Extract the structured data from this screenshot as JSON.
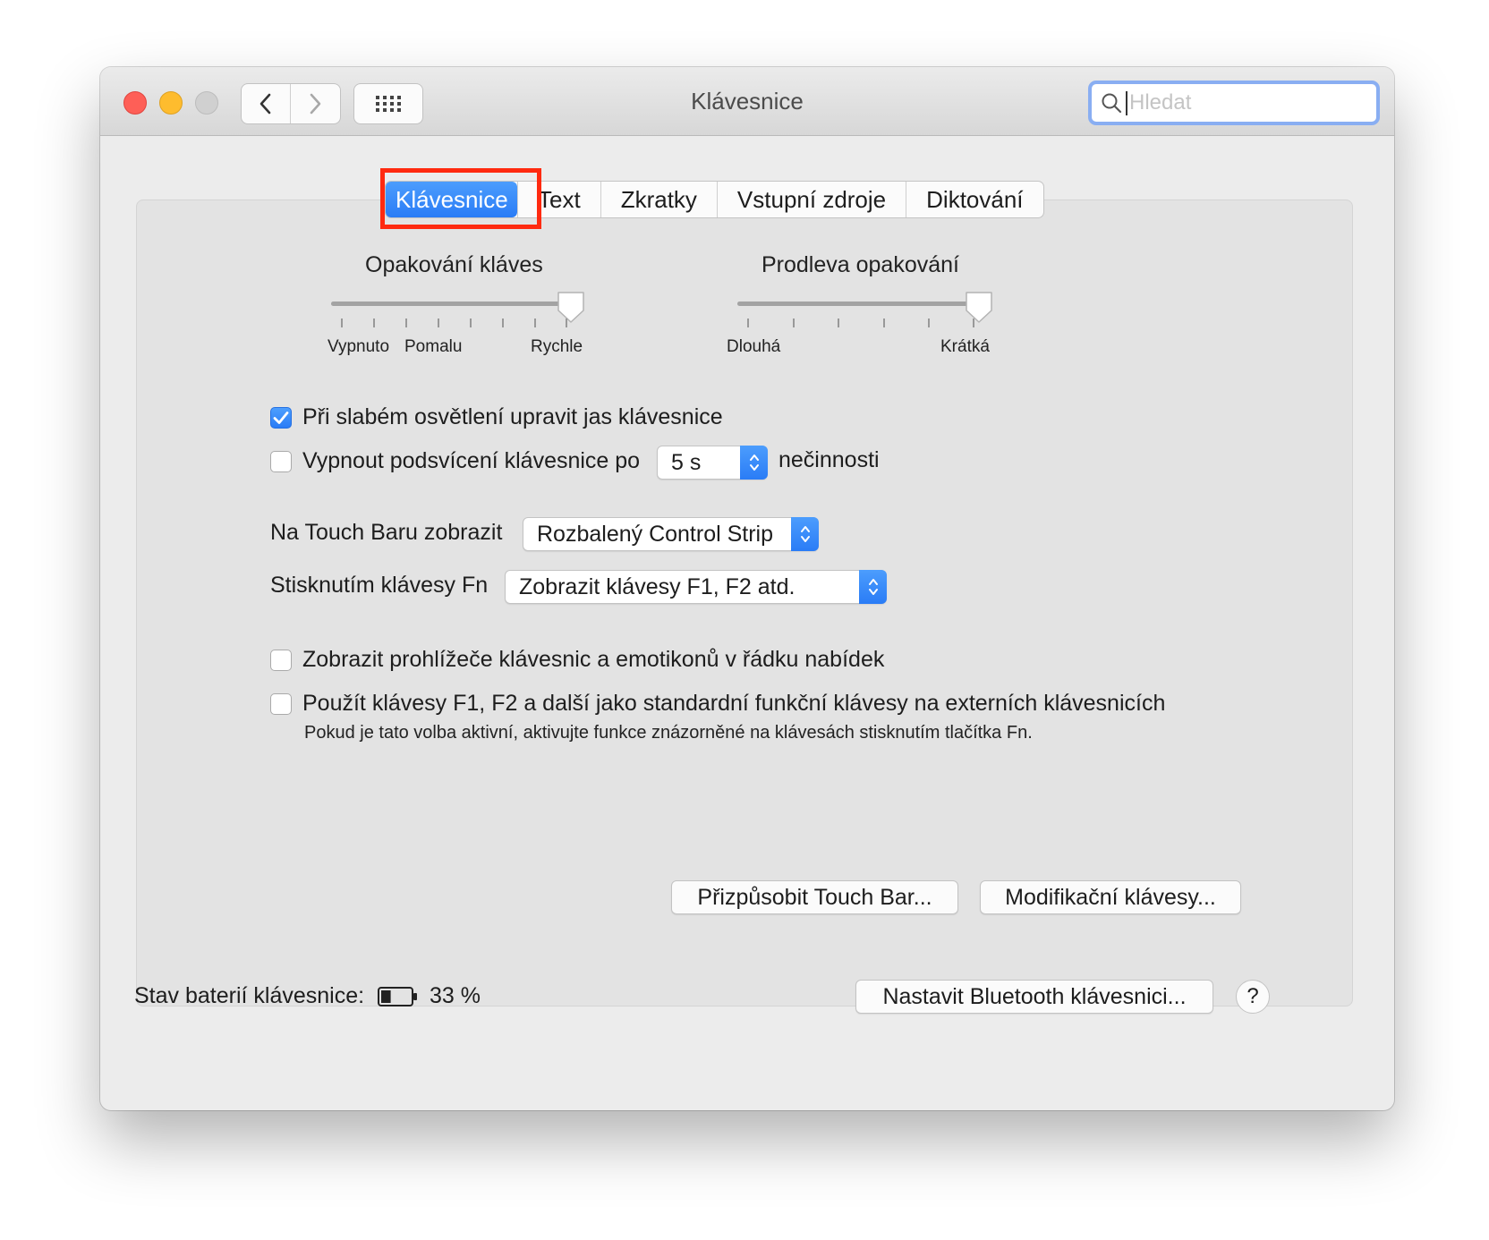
{
  "window": {
    "title": "Klávesnice"
  },
  "toolbar": {
    "search_placeholder": "Hledat"
  },
  "tabs": [
    {
      "label": "Klávesnice",
      "active": true
    },
    {
      "label": "Text",
      "active": false
    },
    {
      "label": "Zkratky",
      "active": false
    },
    {
      "label": "Vstupní zdroje",
      "active": false
    },
    {
      "label": "Diktování",
      "active": false
    }
  ],
  "key_repeat": {
    "title": "Opakování kláves",
    "labels": [
      "Vypnuto",
      "Pomalu",
      "Rychle"
    ],
    "value_fraction": 1.0
  },
  "repeat_delay": {
    "title": "Prodleva opakování",
    "labels": [
      "Dlouhá",
      "Krátká"
    ],
    "value_fraction": 1.0
  },
  "options": {
    "adjust_brightness": {
      "label": "Při slabém osvětlení upravit jas klávesnice",
      "checked": true
    },
    "backlight_off": {
      "label": "Vypnout podsvícení klávesnice po",
      "checked": false,
      "value": "5 s",
      "suffix": "nečinnosti"
    },
    "touch_bar": {
      "label": "Na Touch Baru zobrazit",
      "value": "Rozbalený Control Strip"
    },
    "fn_key": {
      "label": "Stisknutím klávesy Fn",
      "value": "Zobrazit klávesy F1, F2 atd."
    },
    "show_viewers": {
      "label": "Zobrazit prohlížeče klávesnic a emotikonů v řádku nabídek",
      "checked": false
    },
    "use_fkeys": {
      "label": "Použít klávesy F1, F2 a další jako standardní funkční klávesy na externích klávesnicích",
      "checked": false,
      "note": "Pokud je tato volba aktivní, aktivujte funkce znázorněné na klávesách stisknutím tlačítka Fn."
    }
  },
  "buttons": {
    "customize_touch_bar": "Přizpůsobit Touch Bar...",
    "modifier_keys": "Modifikační klávesy...",
    "setup_bluetooth": "Nastavit Bluetooth klávesnici...",
    "help": "?"
  },
  "battery": {
    "label": "Stav baterií klávesnice:",
    "value": "33 %",
    "level": 0.33
  },
  "colors": {
    "accent": "#2a7cf6",
    "highlight_box": "#ff2a10"
  }
}
